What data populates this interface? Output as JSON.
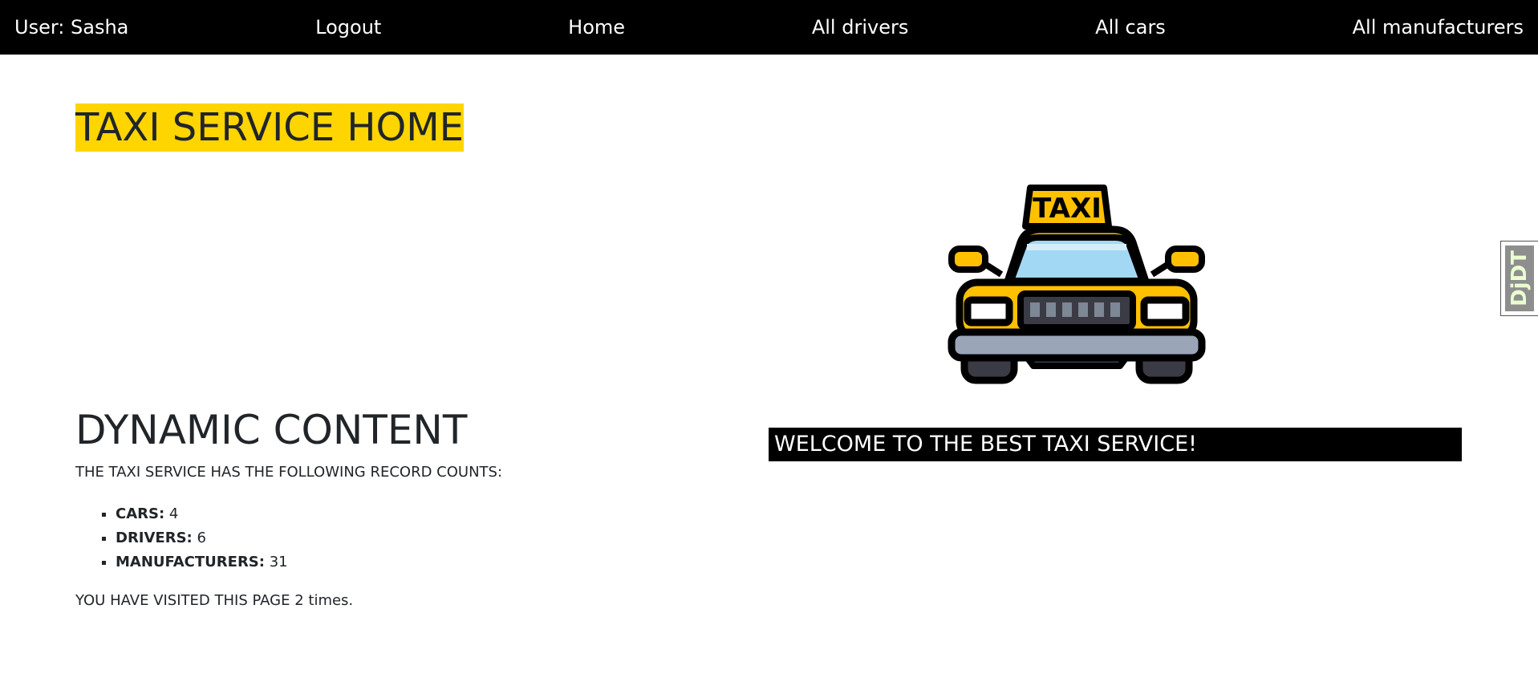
{
  "nav": {
    "user": "User: Sasha",
    "logout": "Logout",
    "home": "Home",
    "drivers": "All drivers",
    "cars": "All cars",
    "manufacturers": "All manufacturers"
  },
  "main": {
    "title": "TAXI SERVICE HOME",
    "dynamic_title": "DYNAMIC CONTENT",
    "counts_intro": "THE TAXI SERVICE HAS THE FOLLOWING RECORD COUNTS:",
    "counts": [
      {
        "label": "CARS:",
        "value": "4"
      },
      {
        "label": "DRIVERS:",
        "value": "6"
      },
      {
        "label": "MANUFACTURERS:",
        "value": "31"
      }
    ],
    "visits": "YOU HAVE VISITED THIS PAGE 2 times."
  },
  "hero": {
    "taxi_sign": "TAXI",
    "welcome": "WELCOME TO THE BEST TAXI SERVICE!"
  },
  "debug_toolbar": {
    "label": "DjDT"
  },
  "colors": {
    "nav_bg": "#000000",
    "title_highlight": "#ffd500",
    "taxi_yellow": "#ffc000",
    "windshield": "#a3d8f4",
    "bumper": "#9aa5b8"
  }
}
